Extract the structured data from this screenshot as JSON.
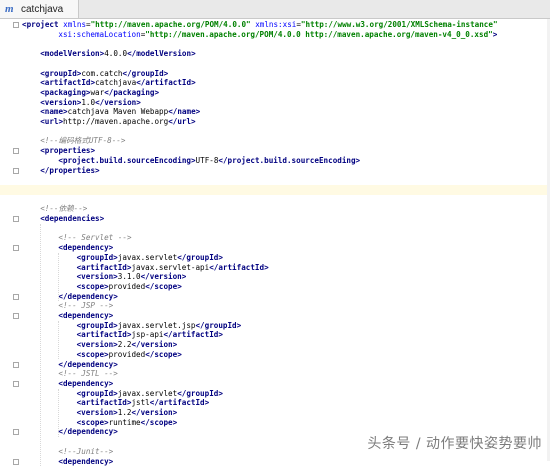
{
  "tab": {
    "title": "catchjava",
    "icon": "maven-m-icon",
    "icon_glyph": "m"
  },
  "lines": [
    {
      "indent": 0,
      "fold": true,
      "segments": [
        [
          "t",
          "<project "
        ],
        [
          "a",
          "xmlns"
        ],
        [
          "x",
          "="
        ],
        [
          "s",
          "\"http://maven.apache.org/POM/4.0.0\""
        ],
        [
          "x",
          " "
        ],
        [
          "a",
          "xmlns:xsi"
        ],
        [
          "x",
          "="
        ],
        [
          "s",
          "\"http://www.w3.org/2001/XMLSchema-instance\""
        ]
      ]
    },
    {
      "indent": 4,
      "segments": [
        [
          "a",
          "xsi:schemaLocation"
        ],
        [
          "x",
          "="
        ],
        [
          "s",
          "\"http://maven.apache.org/POM/4.0.0 http://maven.apache.org/maven-v4_0_0.xsd\""
        ],
        [
          "t",
          ">"
        ]
      ]
    },
    {
      "indent": 0,
      "segments": []
    },
    {
      "indent": 2,
      "segments": [
        [
          "t",
          "<modelVersion>"
        ],
        [
          "x",
          "4.0.0"
        ],
        [
          "t",
          "</modelVersion>"
        ]
      ]
    },
    {
      "indent": 0,
      "segments": []
    },
    {
      "indent": 2,
      "segments": [
        [
          "t",
          "<groupId>"
        ],
        [
          "x",
          "com.catch"
        ],
        [
          "t",
          "</groupId>"
        ]
      ]
    },
    {
      "indent": 2,
      "segments": [
        [
          "t",
          "<artifactId>"
        ],
        [
          "x",
          "catchjava"
        ],
        [
          "t",
          "</artifactId>"
        ]
      ]
    },
    {
      "indent": 2,
      "segments": [
        [
          "t",
          "<packaging>"
        ],
        [
          "x",
          "war"
        ],
        [
          "t",
          "</packaging>"
        ]
      ]
    },
    {
      "indent": 2,
      "segments": [
        [
          "t",
          "<version>"
        ],
        [
          "x",
          "1.0"
        ],
        [
          "t",
          "</version>"
        ]
      ]
    },
    {
      "indent": 2,
      "segments": [
        [
          "t",
          "<name>"
        ],
        [
          "x",
          "catchjava Maven Webapp"
        ],
        [
          "t",
          "</name>"
        ]
      ]
    },
    {
      "indent": 2,
      "segments": [
        [
          "t",
          "<url>"
        ],
        [
          "x",
          "http://maven.apache.org"
        ],
        [
          "t",
          "</url>"
        ]
      ]
    },
    {
      "indent": 0,
      "segments": []
    },
    {
      "indent": 2,
      "segments": [
        [
          "c",
          "<!--编码格式UTF-8-->"
        ]
      ]
    },
    {
      "indent": 2,
      "fold": true,
      "segments": [
        [
          "t",
          "<properties>"
        ]
      ]
    },
    {
      "indent": 4,
      "segments": [
        [
          "t",
          "<project.build.sourceEncoding>"
        ],
        [
          "x",
          "UTF-8"
        ],
        [
          "t",
          "</project.build.sourceEncoding>"
        ]
      ]
    },
    {
      "indent": 2,
      "fold": true,
      "segments": [
        [
          "t",
          "</properties>"
        ]
      ]
    },
    {
      "indent": 0,
      "segments": []
    },
    {
      "indent": 0,
      "current": true,
      "segments": []
    },
    {
      "indent": 0,
      "segments": []
    },
    {
      "indent": 2,
      "segments": [
        [
          "c",
          "<!--依赖-->"
        ]
      ]
    },
    {
      "indent": 2,
      "fold": true,
      "segments": [
        [
          "t",
          "<dependencies>"
        ]
      ]
    },
    {
      "indent": 0,
      "segments": []
    },
    {
      "indent": 4,
      "segments": [
        [
          "c",
          "<!-- Servlet -->"
        ]
      ]
    },
    {
      "indent": 4,
      "fold": true,
      "segments": [
        [
          "t",
          "<dependency>"
        ]
      ]
    },
    {
      "indent": 6,
      "segments": [
        [
          "t",
          "<groupId>"
        ],
        [
          "x",
          "javax.servlet"
        ],
        [
          "t",
          "</groupId>"
        ]
      ]
    },
    {
      "indent": 6,
      "segments": [
        [
          "t",
          "<artifactId>"
        ],
        [
          "x",
          "javax.servlet-api"
        ],
        [
          "t",
          "</artifactId>"
        ]
      ]
    },
    {
      "indent": 6,
      "segments": [
        [
          "t",
          "<version>"
        ],
        [
          "x",
          "3.1.0"
        ],
        [
          "t",
          "</version>"
        ]
      ]
    },
    {
      "indent": 6,
      "segments": [
        [
          "t",
          "<scope>"
        ],
        [
          "x",
          "provided"
        ],
        [
          "t",
          "</scope>"
        ]
      ]
    },
    {
      "indent": 4,
      "fold": true,
      "segments": [
        [
          "t",
          "</dependency>"
        ]
      ]
    },
    {
      "indent": 4,
      "segments": [
        [
          "c",
          "<!-- JSP -->"
        ]
      ]
    },
    {
      "indent": 4,
      "fold": true,
      "segments": [
        [
          "t",
          "<dependency>"
        ]
      ]
    },
    {
      "indent": 6,
      "segments": [
        [
          "t",
          "<groupId>"
        ],
        [
          "x",
          "javax.servlet.jsp"
        ],
        [
          "t",
          "</groupId>"
        ]
      ]
    },
    {
      "indent": 6,
      "segments": [
        [
          "t",
          "<artifactId>"
        ],
        [
          "x",
          "jsp-api"
        ],
        [
          "t",
          "</artifactId>"
        ]
      ]
    },
    {
      "indent": 6,
      "segments": [
        [
          "t",
          "<version>"
        ],
        [
          "x",
          "2.2"
        ],
        [
          "t",
          "</version>"
        ]
      ]
    },
    {
      "indent": 6,
      "segments": [
        [
          "t",
          "<scope>"
        ],
        [
          "x",
          "provided"
        ],
        [
          "t",
          "</scope>"
        ]
      ]
    },
    {
      "indent": 4,
      "fold": true,
      "segments": [
        [
          "t",
          "</dependency>"
        ]
      ]
    },
    {
      "indent": 4,
      "segments": [
        [
          "c",
          "<!-- JSTL -->"
        ]
      ]
    },
    {
      "indent": 4,
      "fold": true,
      "segments": [
        [
          "t",
          "<dependency>"
        ]
      ]
    },
    {
      "indent": 6,
      "segments": [
        [
          "t",
          "<groupId>"
        ],
        [
          "x",
          "javax.servlet"
        ],
        [
          "t",
          "</groupId>"
        ]
      ]
    },
    {
      "indent": 6,
      "segments": [
        [
          "t",
          "<artifactId>"
        ],
        [
          "x",
          "jstl"
        ],
        [
          "t",
          "</artifactId>"
        ]
      ]
    },
    {
      "indent": 6,
      "segments": [
        [
          "t",
          "<version>"
        ],
        [
          "x",
          "1.2"
        ],
        [
          "t",
          "</version>"
        ]
      ]
    },
    {
      "indent": 6,
      "segments": [
        [
          "t",
          "<scope>"
        ],
        [
          "x",
          "runtime"
        ],
        [
          "t",
          "</scope>"
        ]
      ]
    },
    {
      "indent": 4,
      "fold": true,
      "segments": [
        [
          "t",
          "</dependency>"
        ]
      ]
    },
    {
      "indent": 0,
      "segments": []
    },
    {
      "indent": 4,
      "segments": [
        [
          "c",
          "<!--Junit-->"
        ]
      ]
    },
    {
      "indent": 4,
      "fold": true,
      "segments": [
        [
          "t",
          "<dependency>"
        ]
      ]
    }
  ],
  "watermark": "头条号 / 动作要快姿势要帅"
}
